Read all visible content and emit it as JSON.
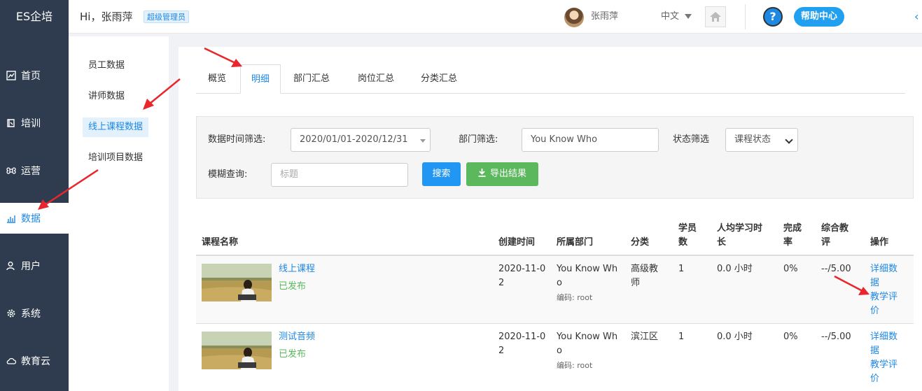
{
  "app": {
    "logo": "ES企培"
  },
  "sidebar": {
    "items": [
      {
        "label": "首页",
        "icon": "chart-icon"
      },
      {
        "label": "培训",
        "icon": "book-icon"
      },
      {
        "label": "运营",
        "icon": "command-icon"
      },
      {
        "label": "数据",
        "icon": "bar-chart-icon",
        "active": true
      },
      {
        "label": "用户",
        "icon": "user-icon"
      },
      {
        "label": "系统",
        "icon": "gear-icon"
      },
      {
        "label": "教育云",
        "icon": "cloud-icon"
      }
    ]
  },
  "header": {
    "greeting": "Hi，张雨萍",
    "role_badge": "超级管理员",
    "username": "张雨萍",
    "language": "中文",
    "help_label": "帮助中心",
    "help_symbol": "?"
  },
  "subnav": {
    "items": [
      {
        "label": "员工数据"
      },
      {
        "label": "讲师数据"
      },
      {
        "label": "线上课程数据",
        "active": true
      },
      {
        "label": "培训项目数据"
      }
    ]
  },
  "tabs": [
    {
      "label": "概览"
    },
    {
      "label": "明细",
      "active": true
    },
    {
      "label": "部门汇总"
    },
    {
      "label": "岗位汇总"
    },
    {
      "label": "分类汇总"
    }
  ],
  "filters": {
    "date_label": "数据时间筛选:",
    "date_value": "2020/01/01-2020/12/31",
    "dept_label": "部门筛选:",
    "dept_value": "You Know Who",
    "status_label": "状态筛选",
    "status_value": "课程状态",
    "keyword_label": "模糊查询:",
    "keyword_placeholder": "标题",
    "search_button": "搜索",
    "export_button": "导出结果"
  },
  "table": {
    "columns": [
      "课程名称",
      "创建时间",
      "所属部门",
      "分类",
      "学员数",
      "人均学习时长",
      "完成率",
      "综合教评",
      "操作"
    ],
    "rows": [
      {
        "title": "线上课程",
        "status": "已发布",
        "created": "2020-11-02",
        "dept": "You Know Who",
        "dept_code": "编码: root",
        "category": "高级教师",
        "students": "1",
        "avg_time": "0.0 小时",
        "completion": "0%",
        "rating": "--/5.00",
        "op_detail": "详细数据",
        "op_eval": "教学评价"
      },
      {
        "title": "测试音频",
        "status": "已发布",
        "created": "2020-11-02",
        "dept": "You Know Who",
        "dept_code": "编码: root",
        "category": "滨江区",
        "students": "1",
        "avg_time": "0.0 小时",
        "completion": "0%",
        "rating": "--/5.00",
        "op_detail": "详细数据",
        "op_eval": "教学评价"
      }
    ]
  },
  "colors": {
    "sidebar_bg": "#2f3c50",
    "accent": "#1e88e5",
    "success": "#5cb85c",
    "annotation_arrow": "#e8262b"
  }
}
